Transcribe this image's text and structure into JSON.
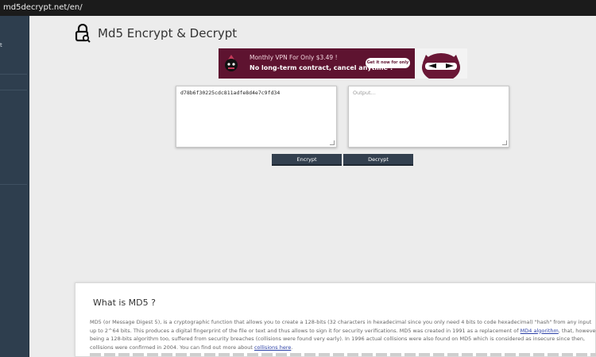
{
  "browser": {
    "url": "md5decrypt.net/en/"
  },
  "sidebar": {
    "mark": "t"
  },
  "header": {
    "title": "Md5 Encrypt & Decrypt"
  },
  "ad": {
    "line1": "Monthly VPN For Only $3.49 !",
    "line2": "No long-term contract, cancel anytime !",
    "cta": "Get it now for only $3.49"
  },
  "input": {
    "value": "d78b6f30225cdc811adfe8d4e7c9fd34",
    "placeholder": ""
  },
  "output": {
    "value": "",
    "placeholder": "Output..."
  },
  "buttons": {
    "encrypt": "Encrypt",
    "decrypt": "Decrypt"
  },
  "about": {
    "title": "What is MD5 ?",
    "p1a": "MD5 (or Message Digest 5), is a cryptographic function that allows you to create a 128-bits (32 characters in hexadecimal since you only need 4 bits to code hexadecimal) \"hash\" from any input up to 2^64 bits. This produces a digital fingerprint of the file or text and thus allows to sign it for security verifications. MD5 was created in 1991 as a replacement of ",
    "link1": "MD4 algorithm",
    "p1b": ", that, however being a 128-bits algorithm too, suffered from security breaches (collisions were found very early). In 1996 actual collisions were also found on MD5 which is considered as insecure since then, collisions were confirmed in 2004. You can find out more about ",
    "link2": "collisions here",
    "p1c": "."
  }
}
